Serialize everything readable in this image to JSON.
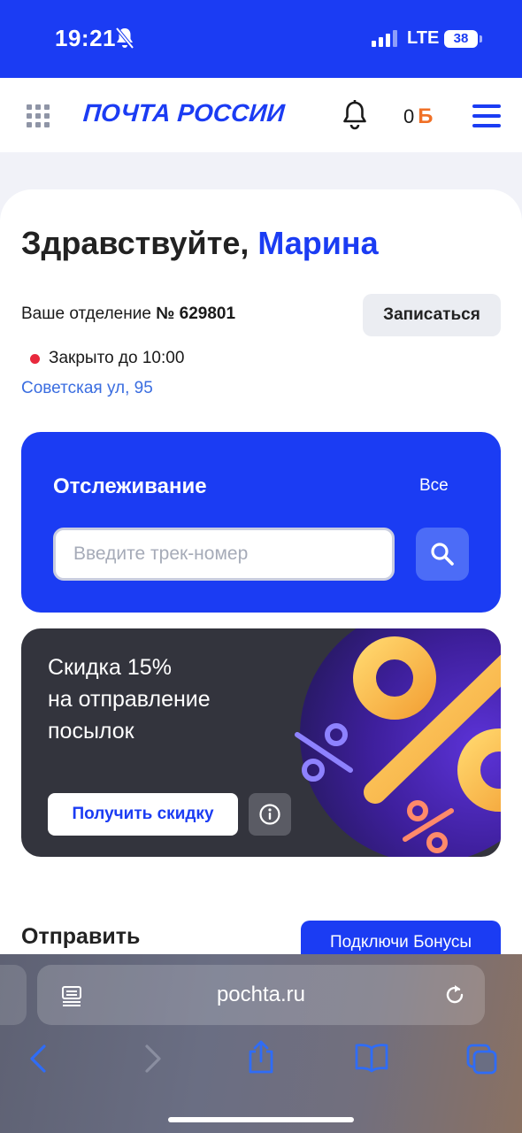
{
  "status_bar": {
    "time": "19:21",
    "network": "LTE",
    "battery": "38"
  },
  "header": {
    "logo": "ПОЧТА РОССИИ",
    "points": "0"
  },
  "greeting": {
    "prefix": "Здравствуйте, ",
    "name": "Марина"
  },
  "office": {
    "label": "Ваше отделение ",
    "number": "№ 629801",
    "book_button": "Записаться",
    "status": "Закрыто до 10:00",
    "address": "Советская ул, 95"
  },
  "tracking": {
    "title": "Отслеживание",
    "all_link": "Все",
    "placeholder": "Введите трек-номер",
    "value": ""
  },
  "promo": {
    "line1": "Скидка 15%",
    "line2": "на отправление",
    "line3": "посылок",
    "button": "Получить скидку"
  },
  "send": {
    "title": "Отправить",
    "bonus_button": "Подключи Бонусы"
  },
  "browser": {
    "url": "pochta.ru"
  },
  "colors": {
    "brand": "#1b3cf3",
    "promo_bg": "#33343d",
    "status_closed": "#e8283c",
    "coin": "#f07026"
  },
  "icons": [
    "mute-bell-icon",
    "grid-icon",
    "bell-icon",
    "coin-icon",
    "menu-icon",
    "search-icon",
    "info-icon",
    "reader-icon",
    "reload-icon",
    "back-icon",
    "forward-icon",
    "share-icon",
    "bookmarks-icon",
    "tabs-icon"
  ]
}
